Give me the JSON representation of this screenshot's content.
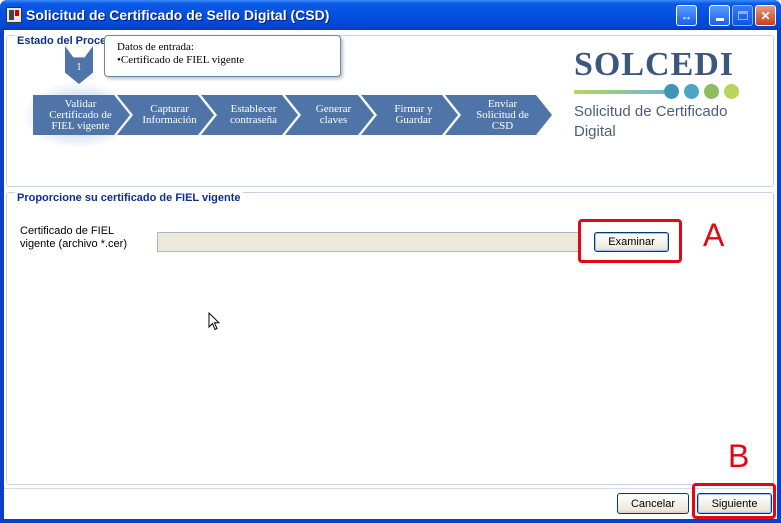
{
  "window": {
    "title": "Solicitud de Certificado de Sello Digital (CSD)",
    "controls": [
      "restore-swap",
      "minimize",
      "maximize",
      "close"
    ]
  },
  "status_group": {
    "title": "Estado del Proceso",
    "current_step_number": "1",
    "input_box": {
      "heading": "Datos de entrada:",
      "item": "•Certificado de FIEL vigente"
    },
    "steps": [
      {
        "line1": "Validar",
        "line2": "Certificado de",
        "line3": "FIEL  vigente"
      },
      {
        "line1": "Capturar",
        "line2": "Información",
        "line3": ""
      },
      {
        "line1": "Establecer",
        "line2": "contraseña",
        "line3": ""
      },
      {
        "line1": "Generar",
        "line2": "claves",
        "line3": ""
      },
      {
        "line1": "Firmar y",
        "line2": "Guardar",
        "line3": ""
      },
      {
        "line1": "Enviar",
        "line2": "Solicitud de",
        "line3": "CSD"
      }
    ],
    "logo": {
      "word": "SOLCEDI",
      "subtitle_line1": "Solicitud de Certificado",
      "subtitle_line2": "Digital",
      "dot_colors": [
        "#3f95b8",
        "#4aa6c2",
        "#8ebc5f",
        "#b9d55a"
      ]
    }
  },
  "cert_group": {
    "title": "Proporcione su certificado de FIEL vigente",
    "field_label_line1": "Certificado de FIEL",
    "field_label_line2": "vigente (archivo *.cer)",
    "file_value": "",
    "browse_label": "Examinar"
  },
  "footer": {
    "cancel_label": "Cancelar",
    "next_label": "Siguiente"
  },
  "annotations": {
    "a_label": "A",
    "b_label": "B",
    "color": "#e30613"
  },
  "colors": {
    "step_arrow": "#4f74a8",
    "group_title": "#0c2f8c",
    "titlebar": "#0450e0"
  }
}
